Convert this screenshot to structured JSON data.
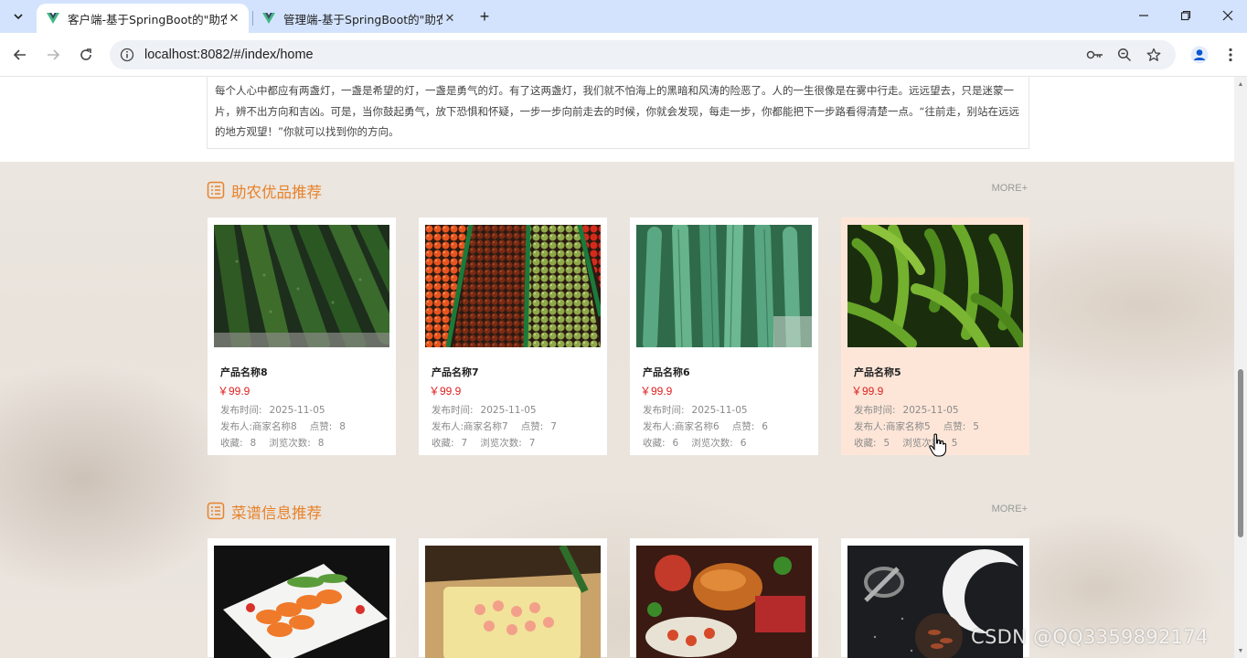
{
  "browser": {
    "tabs": [
      {
        "title": "客户端-基于SpringBoot的\"助农",
        "active": true
      },
      {
        "title": "管理端-基于SpringBoot的\"助农",
        "active": false
      }
    ],
    "close_glyph": "✕",
    "new_tab_glyph": "+",
    "url": "localhost:8082/#/index/home",
    "accent_color": "#d3e3fd"
  },
  "intro": {
    "text": "每个人心中都应有两盏灯，一盏是希望的灯，一盏是勇气的灯。有了这两盏灯，我们就不怕海上的黑暗和风涛的险恶了。人的一生很像是在雾中行走。远远望去，只是迷蒙一片，辨不出方向和吉凶。可是，当你鼓起勇气，放下恐惧和怀疑，一步一步向前走去的时候，你就会发现，每走一步，你都能把下一步路看得清楚一点。“往前走，别站在远远的地方观望！”你就可以找到你的方向。"
  },
  "products_section": {
    "title": "助农优品推荐",
    "more": "MORE+",
    "title_color": "#e8822a",
    "labels": {
      "time": "发布时间:",
      "publisher": "发布人:",
      "likes": "点赞:",
      "favorites": "收藏:",
      "views": "浏览次数:"
    },
    "items": [
      {
        "name": "产品名称8",
        "price": "￥99.9",
        "time": "2025-11-05",
        "publisher": "商家名称8",
        "likes": "8",
        "favorites": "8",
        "views": "8",
        "image": "cucumber-photo"
      },
      {
        "name": "产品名称7",
        "price": "￥99.9",
        "time": "2025-11-05",
        "publisher": "商家名称7",
        "likes": "7",
        "favorites": "7",
        "views": "7",
        "image": "tomato-photo"
      },
      {
        "name": "产品名称6",
        "price": "￥99.9",
        "time": "2025-11-05",
        "publisher": "商家名称6",
        "likes": "6",
        "favorites": "6",
        "views": "6",
        "image": "loofah-photo"
      },
      {
        "name": "产品名称5",
        "price": "￥99.9",
        "time": "2025-11-05",
        "publisher": "商家名称5",
        "likes": "5",
        "favorites": "5",
        "views": "5",
        "image": "pepper-photo"
      }
    ]
  },
  "recipes_section": {
    "title": "菜谱信息推荐",
    "more": "MORE+",
    "items": [
      {
        "image": "sliced-dish-photo"
      },
      {
        "image": "shrimp-dish-photo"
      },
      {
        "image": "roast-feast-photo"
      },
      {
        "image": "spice-bowls-photo"
      }
    ]
  },
  "watermark": "CSDN @QQ3359892174"
}
